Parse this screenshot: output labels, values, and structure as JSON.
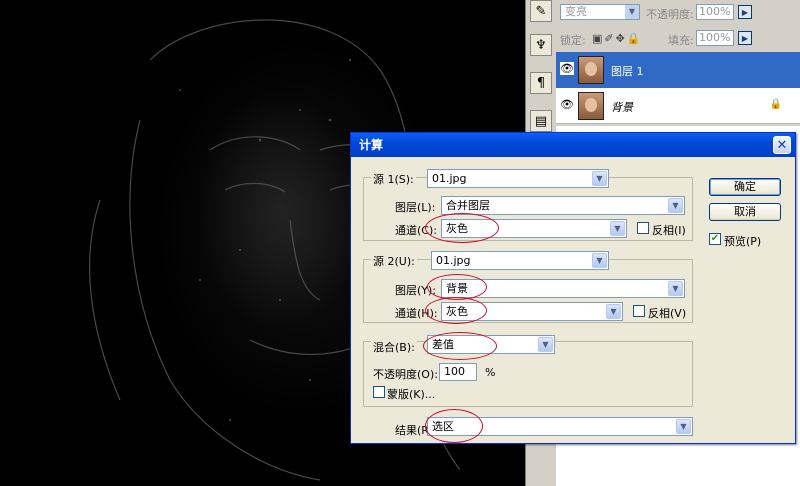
{
  "layers_panel": {
    "blend_mode": "变亮",
    "opacity_label": "不透明度:",
    "opacity_value": "100%",
    "lock_label": "锁定:",
    "fill_label": "填充:",
    "fill_value": "100%",
    "layers": [
      {
        "name": "图层 1",
        "selected": true
      },
      {
        "name": "背景",
        "locked": true
      }
    ]
  },
  "dialog": {
    "title": "计算",
    "source1": {
      "label": "源 1(S):",
      "file": "01.jpg",
      "layer_label": "图层(L):",
      "layer_value": "合并图层",
      "channel_label": "通道(C):",
      "channel_value": "灰色",
      "invert_label": "反相(I)"
    },
    "source2": {
      "label": "源 2(U):",
      "file": "01.jpg",
      "layer_label": "图层(Y):",
      "layer_value": "背景",
      "channel_label": "通道(H):",
      "channel_value": "灰色",
      "invert_label": "反相(V)"
    },
    "blending": {
      "label": "混合(B):",
      "value": "差值",
      "opacity_label": "不透明度(O):",
      "opacity_value": "100",
      "opacity_unit": "%",
      "mask_label": "蒙版(K)..."
    },
    "result": {
      "label": "结果(R):",
      "value": "选区"
    },
    "ok_label": "确定",
    "cancel_label": "取消",
    "preview_label": "预览(P)",
    "preview_checked": true
  },
  "colors": {
    "highlight_circle": "#c8102e",
    "selection": "#3169c6",
    "titlebar": "#0048d8"
  }
}
